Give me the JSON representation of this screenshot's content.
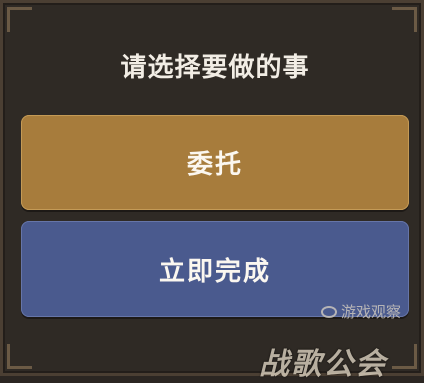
{
  "dialog": {
    "title": "请选择要做的事",
    "options": [
      {
        "label": "委托",
        "color": "#a77c3c"
      },
      {
        "label": "立即完成",
        "color": "#4a5a8e"
      }
    ]
  },
  "watermarks": {
    "source_logo_text": "游戏观察",
    "site_text": "战歌公会"
  }
}
